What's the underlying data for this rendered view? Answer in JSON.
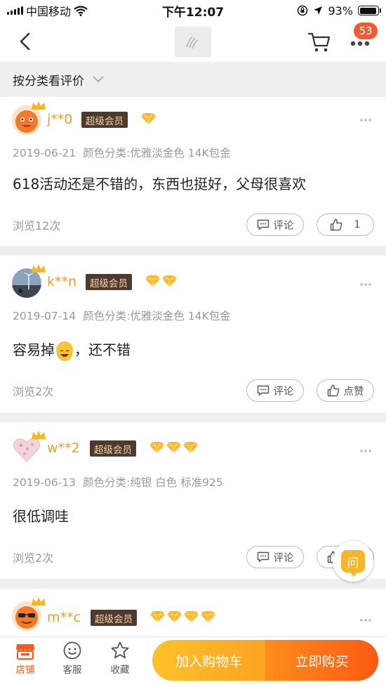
{
  "status_bar": {
    "carrier": "中国移动",
    "time": "下午12:07",
    "battery_percent": "93%",
    "battery_level": 0.93
  },
  "nav": {
    "badge_count": "53"
  },
  "filter": {
    "label": "按分类看评价"
  },
  "reviews": [
    {
      "username": "j**0",
      "vip_label": "超级会员",
      "diamond_count": 1,
      "date": "2019-06-21",
      "sku": "颜色分类:优雅淡金色 14K包金",
      "text_before": "618活动还是不错的，东西也挺好，父母很喜欢",
      "text_after": "",
      "has_emoji": false,
      "views": "浏览12次",
      "comment_label": "评论",
      "like_label": "1"
    },
    {
      "username": "k**n",
      "vip_label": "超级会员",
      "diamond_count": 2,
      "date": "2019-07-14",
      "sku": "颜色分类:优雅淡金色 14K包金",
      "text_before": "容易掉",
      "text_after": "，还不错",
      "has_emoji": true,
      "views": "浏览2次",
      "comment_label": "评论",
      "like_label": "点赞"
    },
    {
      "username": "w**2",
      "vip_label": "超级会员",
      "diamond_count": 3,
      "date": "2019-06-13",
      "sku": "颜色分类:纯银 白色  标准925",
      "text_before": "很低调哇",
      "text_after": "",
      "has_emoji": false,
      "views": "浏览2次",
      "comment_label": "评论",
      "like_label": ""
    },
    {
      "username": "m**c",
      "vip_label": "超级会员",
      "diamond_count": 4
    }
  ],
  "ask_label": "问",
  "bottom_bar": {
    "store": "店铺",
    "service": "客服",
    "favorite": "收藏",
    "add_to_cart": "加入购物车",
    "buy_now": "立即购买"
  },
  "colors": {
    "accent_orange": "#f45b1e",
    "username_gold": "#e2a031",
    "vip_bg": "#4e3a2e",
    "badge_red": "#f35b2f"
  }
}
